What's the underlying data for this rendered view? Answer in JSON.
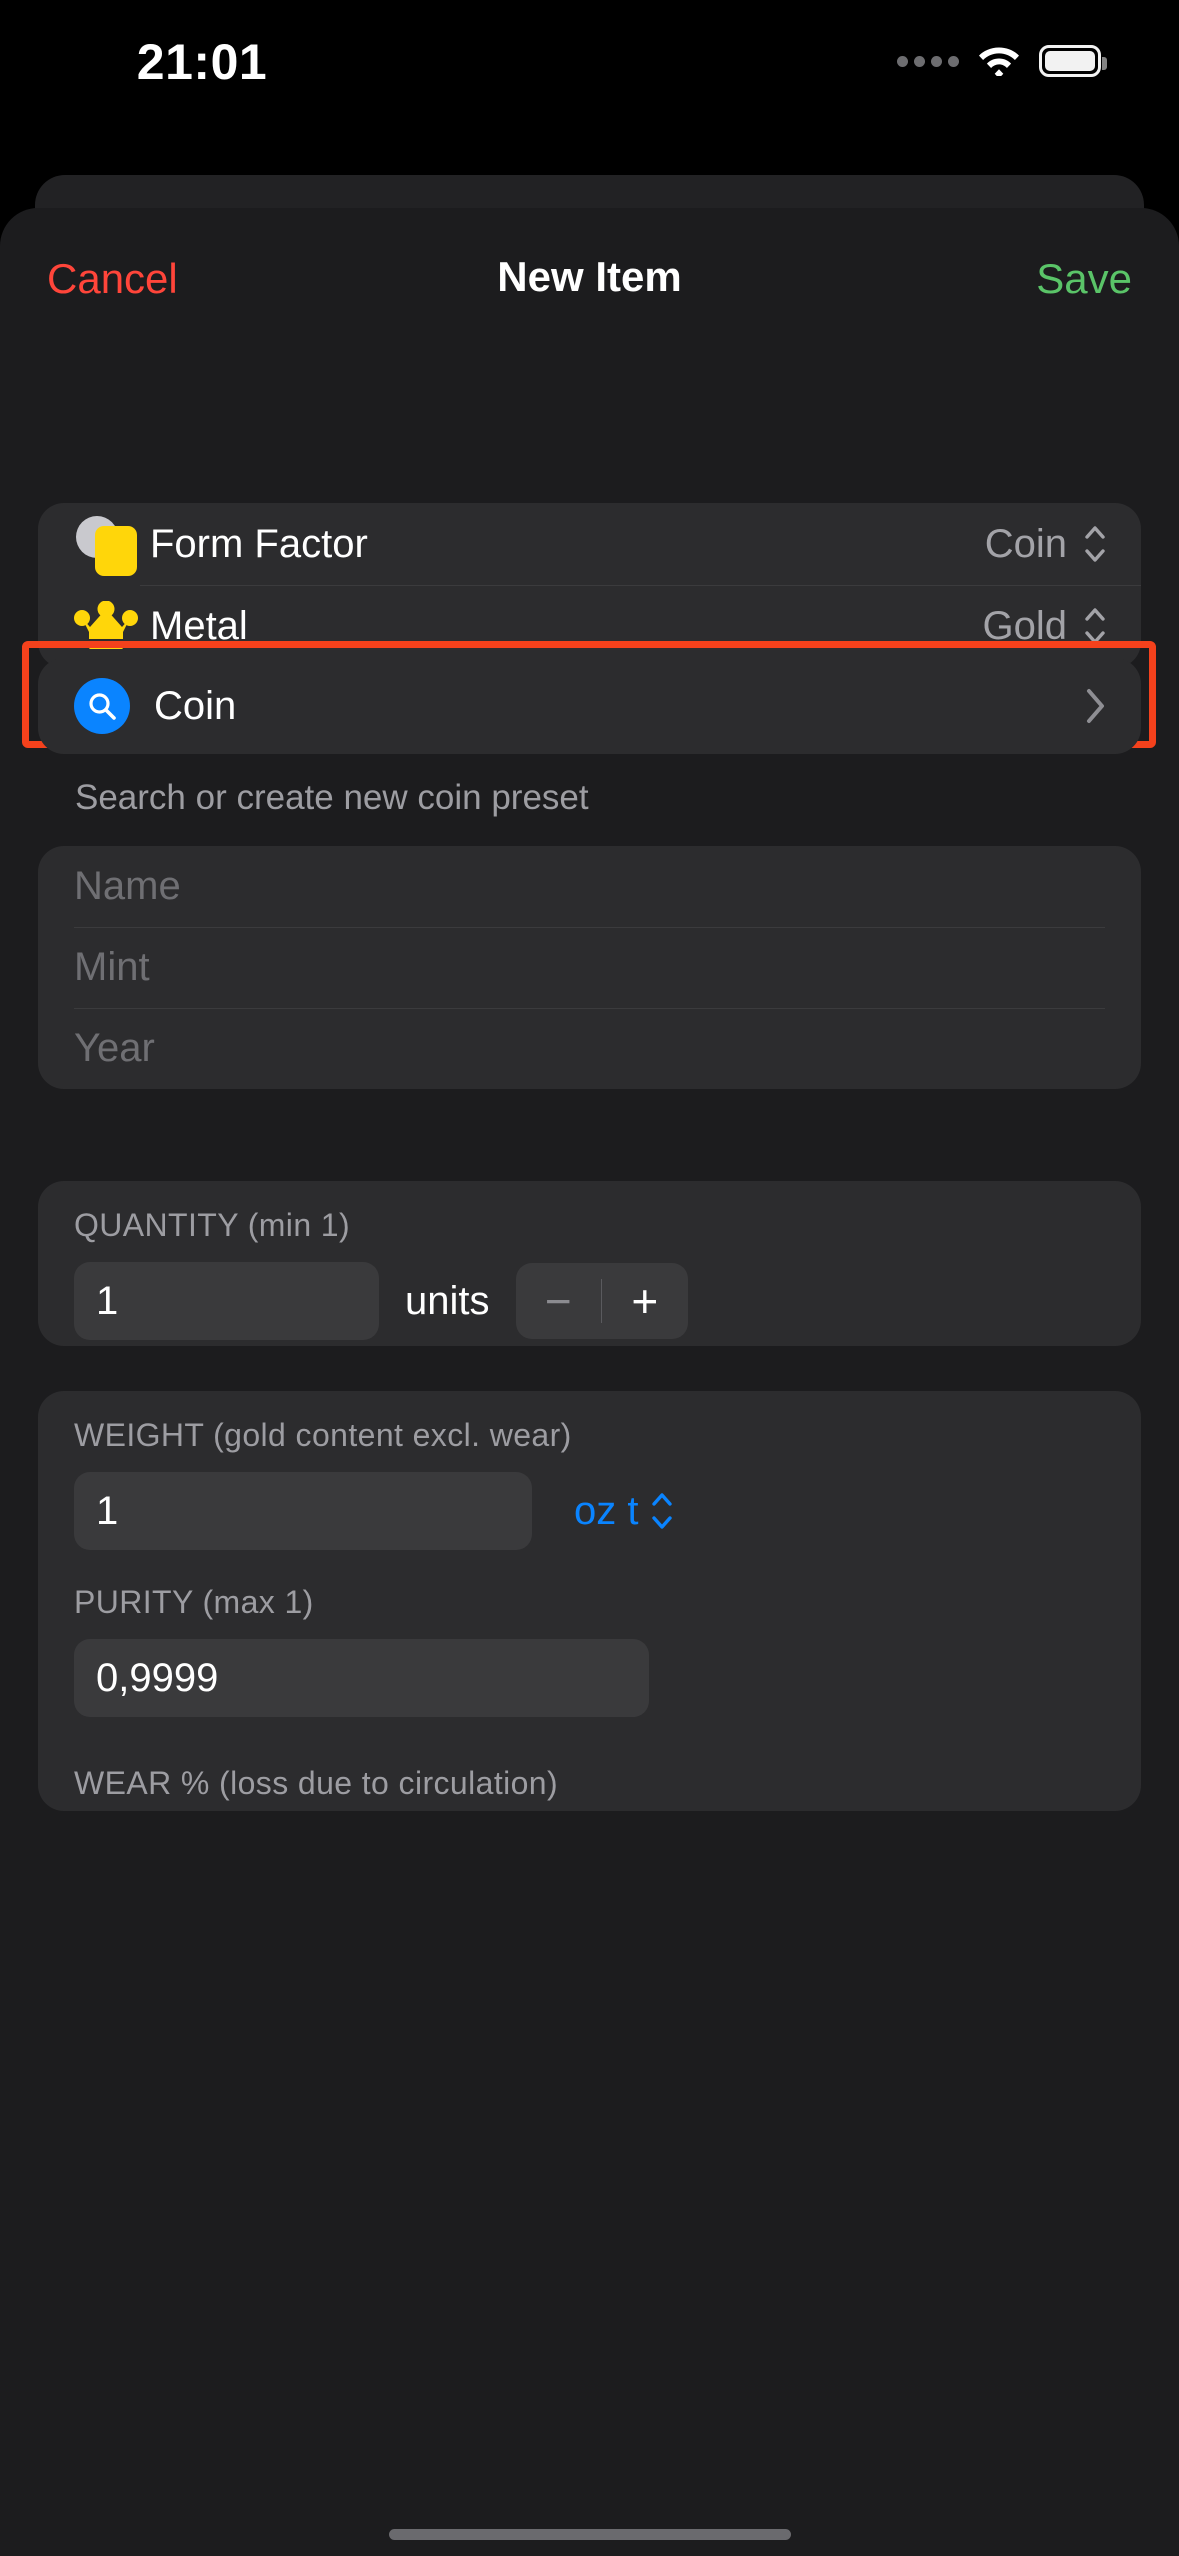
{
  "status_bar": {
    "time": "21:01",
    "cellular_icon": "cellular-dots-icon",
    "wifi_icon": "wifi-icon",
    "battery_icon": "battery-full-icon"
  },
  "navbar": {
    "cancel_label": "Cancel",
    "title": "New Item",
    "save_label": "Save",
    "cancel_color": "#ff453a",
    "save_color": "#5ac468"
  },
  "attributes": {
    "rows": [
      {
        "label": "Form Factor",
        "value": "Coin",
        "icon": "coin-bar-icon"
      },
      {
        "label": "Metal",
        "value": "Gold",
        "icon": "crown-icon"
      }
    ]
  },
  "preset": {
    "label": "Coin",
    "icon": "search-circle-icon",
    "accessory": "chevron-right-icon",
    "helper_text": "Search or create new coin preset",
    "highlight_color": "#f4411c"
  },
  "details": {
    "fields": [
      {
        "placeholder": "Name",
        "value": ""
      },
      {
        "placeholder": "Mint",
        "value": ""
      },
      {
        "placeholder": "Year",
        "value": ""
      }
    ]
  },
  "quantity": {
    "label": "QUANTITY (min 1)",
    "value": "1",
    "units_label": "units",
    "decrement_label": "−",
    "increment_label": "+"
  },
  "weight": {
    "label": "WEIGHT (gold content excl. wear)",
    "value": "1",
    "unit": "oz t",
    "unit_color": "#0a84ff"
  },
  "purity": {
    "label": "PURITY (max 1)",
    "value": "0,9999"
  },
  "wear": {
    "label": "WEAR % (loss due to circulation)"
  }
}
